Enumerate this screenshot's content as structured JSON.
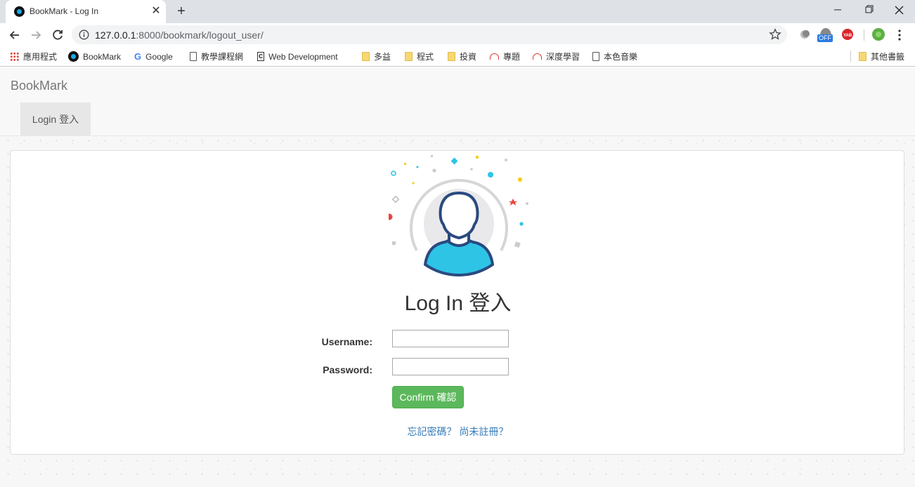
{
  "browser": {
    "tab_title": "BookMark - Log In",
    "url_host": "127.0.0.1",
    "url_rest": ":8000/bookmark/logout_user/",
    "bookmarks": [
      {
        "label": "應用程式",
        "icon": "apps-icon"
      },
      {
        "label": "BookMark",
        "icon": "bookmark-favicon-icon"
      },
      {
        "label": "Google",
        "icon": "google-icon"
      },
      {
        "label": "教學課程網",
        "icon": "page-icon"
      },
      {
        "label": "Web Development",
        "icon": "code-icon"
      },
      {
        "label": "多益",
        "icon": "folder-icon"
      },
      {
        "label": "程式",
        "icon": "folder-icon"
      },
      {
        "label": "投資",
        "icon": "folder-icon"
      },
      {
        "label": "專題",
        "icon": "web-icon"
      },
      {
        "label": "深度學習",
        "icon": "web-icon"
      },
      {
        "label": "本色音樂",
        "icon": "page-icon"
      }
    ],
    "other_bookmarks": "其他書籤",
    "extension_badge": "OFF"
  },
  "navbar": {
    "brand": "BookMark",
    "nav_item": "Login 登入"
  },
  "login": {
    "title": "Log In 登入",
    "username_label": "Username:",
    "username_value": "",
    "password_label": "Password:",
    "password_value": "",
    "confirm_label": "Confirm 確認",
    "forgot_link": "忘記密碼？",
    "register_link": "尚未註冊？"
  },
  "colors": {
    "accent_green": "#5cb85c",
    "link_blue": "#337ab7",
    "avatar_blue": "#2ec4e6",
    "avatar_outline": "#2a4a7f"
  }
}
